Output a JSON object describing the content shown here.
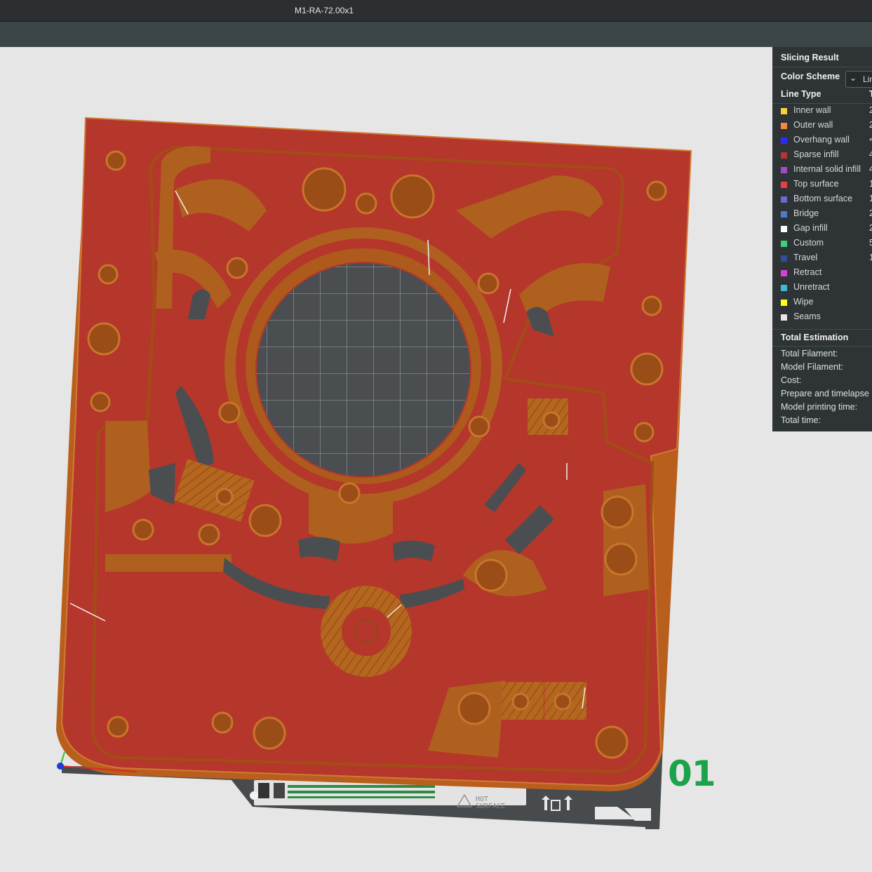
{
  "window": {
    "title": "M1-RA-72.00x1"
  },
  "plate": {
    "number": "01"
  },
  "bed": {
    "warning_label_line1": "HOT",
    "warning_label_line2": "SURFACE"
  },
  "slicing_panel": {
    "title": "Slicing Result",
    "color_scheme_label": "Color Scheme",
    "color_scheme_value": "Lin",
    "line_type_header": "Line Type",
    "second_col_header": "T",
    "line_types": [
      {
        "label": "Inner wall",
        "color": "#f5d33a",
        "value": "2"
      },
      {
        "label": "Outer wall",
        "color": "#f58a3a",
        "value": "2"
      },
      {
        "label": "Overhang wall",
        "color": "#2b2bff",
        "value": "<"
      },
      {
        "label": "Sparse infill",
        "color": "#b5362b",
        "value": "4"
      },
      {
        "label": "Internal solid infill",
        "color": "#9c4fc4",
        "value": "4"
      },
      {
        "label": "Top surface",
        "color": "#e84040",
        "value": "1"
      },
      {
        "label": "Bottom surface",
        "color": "#6a6ad0",
        "value": "1"
      },
      {
        "label": "Bridge",
        "color": "#4c7cc8",
        "value": "2"
      },
      {
        "label": "Gap infill",
        "color": "#ffffff",
        "value": "2"
      },
      {
        "label": "Custom",
        "color": "#3dcf7a",
        "value": "5"
      },
      {
        "label": "Travel",
        "color": "#334d99",
        "value": "1"
      },
      {
        "label": "Retract",
        "color": "#d93fd9",
        "value": ""
      },
      {
        "label": "Unretract",
        "color": "#3fb8d9",
        "value": ""
      },
      {
        "label": "Wipe",
        "color": "#ffff1a",
        "value": ""
      },
      {
        "label": "Seams",
        "color": "#e6e6e6",
        "value": ""
      }
    ],
    "estimation_header": "Total Estimation",
    "estimation": [
      {
        "label": "Total Filament:"
      },
      {
        "label": "Model Filament:"
      },
      {
        "label": "Cost:"
      },
      {
        "label": "Prepare and timelapse"
      },
      {
        "label": "Model printing time:"
      },
      {
        "label": "Total time:"
      }
    ]
  }
}
